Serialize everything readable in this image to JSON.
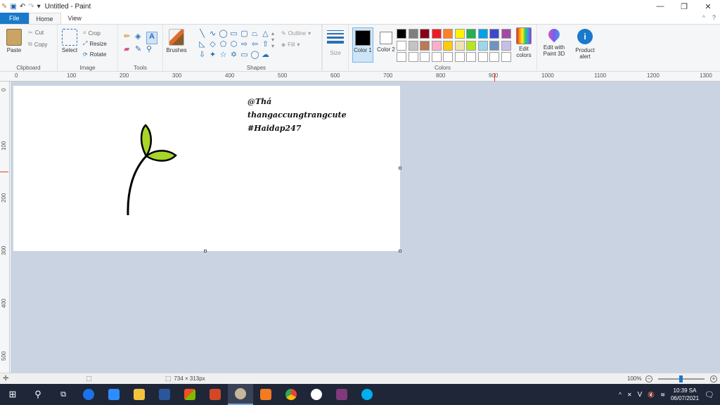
{
  "window": {
    "title": "Untitled - Paint"
  },
  "tabs": {
    "file": "File",
    "home": "Home",
    "view": "View"
  },
  "ribbon": {
    "clipboard": {
      "label": "Clipboard",
      "paste": "Paste",
      "cut": "Cut",
      "copy": "Copy"
    },
    "image": {
      "label": "Image",
      "select": "Select",
      "crop": "Crop",
      "resize": "Resize",
      "rotate": "Rotate"
    },
    "tools": {
      "label": "Tools"
    },
    "brushes": {
      "label": "Brushes"
    },
    "shapes": {
      "label": "Shapes",
      "outline": "Outline",
      "fill": "Fill"
    },
    "size": {
      "label": "Size"
    },
    "colors": {
      "label": "Colors",
      "color1": "Color 1",
      "color2": "Color 2",
      "edit_colors": "Edit colors",
      "swatches": [
        "#000000",
        "#7f7f7f",
        "#880015",
        "#ed1c24",
        "#ff7f27",
        "#fff200",
        "#22b14c",
        "#00a2e8",
        "#3f48cc",
        "#a349a4",
        "#ffffff",
        "#c3c3c3",
        "#b97a57",
        "#ffaec9",
        "#ffc90e",
        "#efe4b0",
        "#b5e61d",
        "#99d9ea",
        "#7092be",
        "#c8bfe7",
        "#ffffff",
        "#ffffff",
        "#ffffff",
        "#ffffff",
        "#ffffff",
        "#ffffff",
        "#ffffff",
        "#ffffff",
        "#ffffff",
        "#ffffff"
      ]
    },
    "edit_paint3d": "Edit with Paint 3D",
    "product_alert": "Product alert"
  },
  "ruler": {
    "h": [
      "0",
      "100",
      "200",
      "300",
      "400",
      "500",
      "600",
      "700",
      "800",
      "900",
      "1000",
      "1100",
      "1200",
      "1300"
    ],
    "v": [
      "0",
      "100",
      "200",
      "300",
      "400",
      "500"
    ]
  },
  "canvas": {
    "line1": "@Thá",
    "line2": "thangaccungtrangcute",
    "line3": "#Haidap247"
  },
  "status": {
    "image_size": "734 × 313px",
    "zoom": "100%"
  },
  "taskbar": {
    "time": "10:39 SA",
    "date": "06/07/2021"
  },
  "accent": "#1979ca",
  "leaf_color": "#a8d52a"
}
